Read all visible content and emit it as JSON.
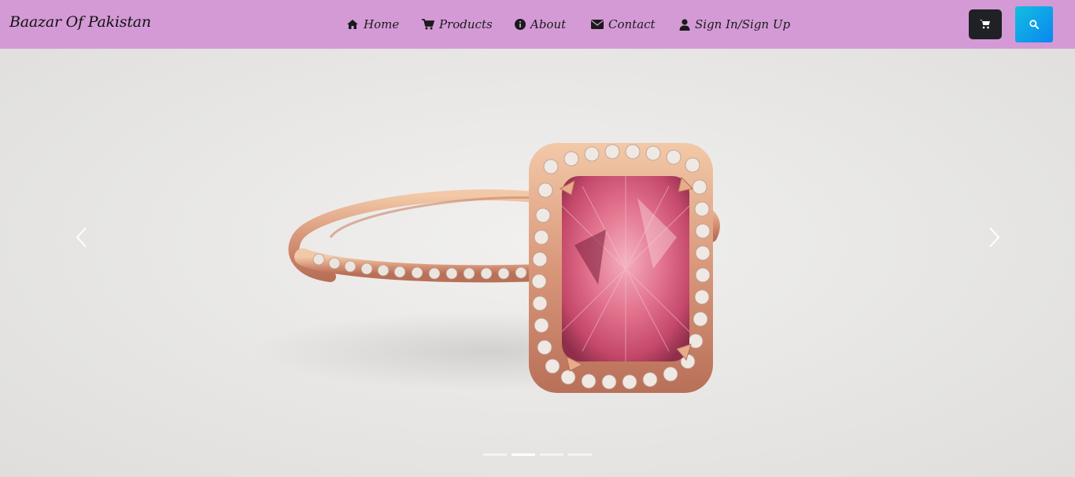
{
  "navbar": {
    "brand": "Baazar Of Pakistan",
    "background": "#d49ad6",
    "items": [
      {
        "label": "Home",
        "icon": "home-icon"
      },
      {
        "label": "Products",
        "icon": "cart-icon"
      },
      {
        "label": "About",
        "icon": "info-icon"
      },
      {
        "label": "Contact",
        "icon": "envelope-icon"
      },
      {
        "label": "Sign In/Sign Up",
        "icon": "user-icon"
      }
    ],
    "cart_button": {
      "icon": "cart-icon",
      "color": "#1f2124"
    },
    "search_button": {
      "icon": "search-icon",
      "color": "#0a9cf0"
    }
  },
  "carousel": {
    "image": "pink-gemstone-ring",
    "slide_count": 4,
    "active_slide": 2,
    "prev_icon": "chevron-left-icon",
    "next_icon": "chevron-right-icon"
  }
}
